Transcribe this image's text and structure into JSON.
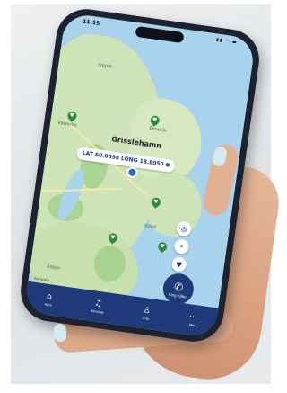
{
  "status": {
    "time": "11:15"
  },
  "map": {
    "place_name": "Grisslehamn",
    "labels": [
      "Fogde",
      "Elmskär",
      "Vasterby",
      "Bjärö",
      "Äsbyn"
    ],
    "attribution": "Kartdata"
  },
  "coord_card": {
    "lat": "LAT 60.0898",
    "long": "LONG 18.8050"
  },
  "call_button": {
    "label": "Ring hjälp"
  },
  "tabs": [
    {
      "label": "Hem"
    },
    {
      "label": "Aktivitet"
    },
    {
      "label": "Info"
    },
    {
      "label": "Mer"
    }
  ],
  "colors": {
    "brand": "#1e3a78",
    "map_water": "#a9d3ec",
    "map_land": "#cfe3b8",
    "pin": "#2e8b3d"
  }
}
